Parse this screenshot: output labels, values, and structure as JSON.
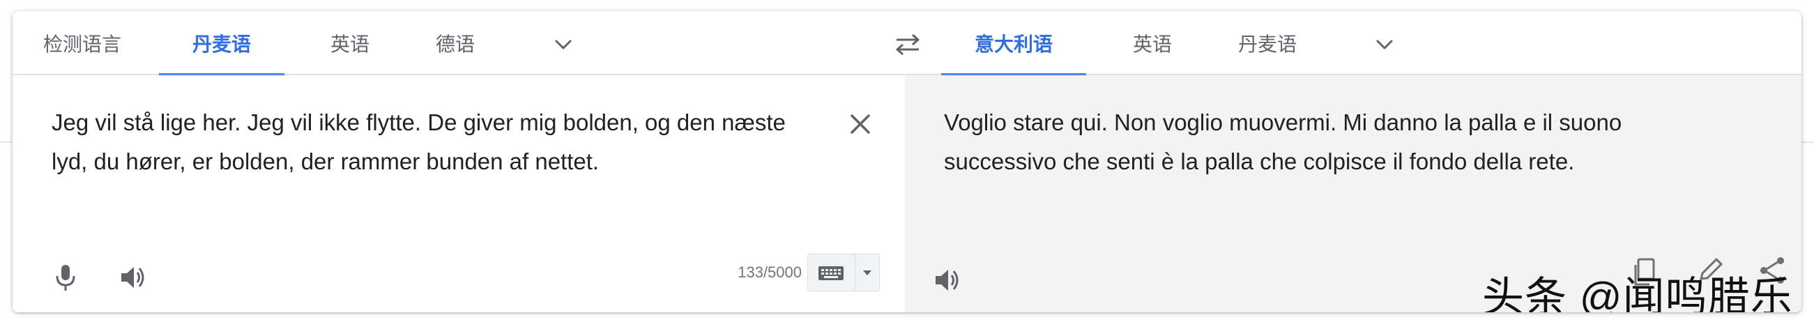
{
  "source_tabs": [
    {
      "label": "检测语言",
      "active": false
    },
    {
      "label": "丹麦语",
      "active": true
    },
    {
      "label": "英语",
      "active": false
    },
    {
      "label": "德语",
      "active": false
    }
  ],
  "target_tabs": [
    {
      "label": "意大利语",
      "active": true
    },
    {
      "label": "英语",
      "active": false
    },
    {
      "label": "丹麦语",
      "active": false
    }
  ],
  "icons": {
    "more_source_languages": "chevron-down-icon",
    "more_target_languages": "chevron-down-icon",
    "swap": "swap-languages-icon",
    "clear": "close-icon",
    "microphone": "microphone-icon",
    "source_speaker": "speaker-icon",
    "keyboard": "keyboard-icon",
    "keyboard_dropdown": "caret-down-icon",
    "target_speaker": "speaker-icon",
    "copy": "copy-icon",
    "edit": "pencil-icon",
    "share": "share-icon"
  },
  "source": {
    "text": "Jeg vil stå lige her. Jeg vil ikke flytte. De giver mig bolden, og den næste lyd, du hører, er bolden, der rammer bunden af nettet.",
    "char_count": "133/5000"
  },
  "target": {
    "text": "Voglio stare qui. Non voglio muovermi. Mi danno la palla e il suono successivo che senti è la palla che colpisce il fondo della rete."
  },
  "watermark": "头条 @闻鸣腊乐",
  "colors": {
    "accent": "#2f6fde",
    "tab_underline": "#4a88e8",
    "target_background": "#f3f3f3",
    "icon": "#5f6368"
  }
}
